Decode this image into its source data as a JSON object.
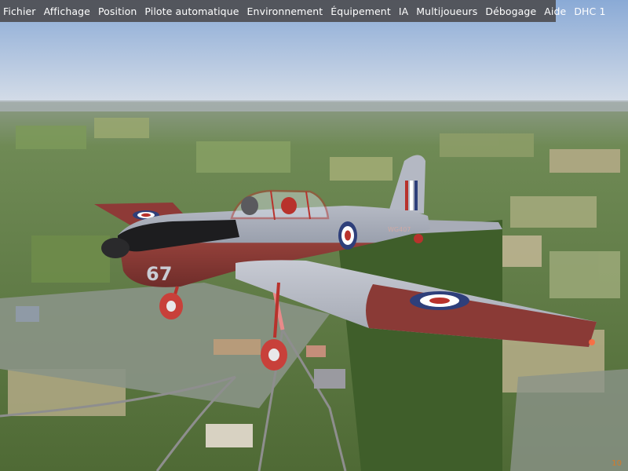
{
  "menu": {
    "items": [
      {
        "id": "fichier",
        "label": "Fichier"
      },
      {
        "id": "affichage",
        "label": "Affichage"
      },
      {
        "id": "position",
        "label": "Position"
      },
      {
        "id": "pilote-automatique",
        "label": "Pilote automatique"
      },
      {
        "id": "environnement",
        "label": "Environnement"
      },
      {
        "id": "equipement",
        "label": "Équipement"
      },
      {
        "id": "ia",
        "label": "IA"
      },
      {
        "id": "multijoueurs",
        "label": "Multijoueurs"
      },
      {
        "id": "debogage",
        "label": "Débogage"
      },
      {
        "id": "aide",
        "label": "Aide"
      },
      {
        "id": "dhc1",
        "label": "DHC 1"
      }
    ]
  },
  "aircraft": {
    "fuselage_number": "67",
    "tail_code": "WG407",
    "colors": {
      "body": "#8a3a36",
      "wing": "#b9bcc6",
      "roundel_outer": "#2e3f7a",
      "roundel_inner": "#b8322c"
    }
  },
  "overlay": {
    "fps": "10"
  }
}
